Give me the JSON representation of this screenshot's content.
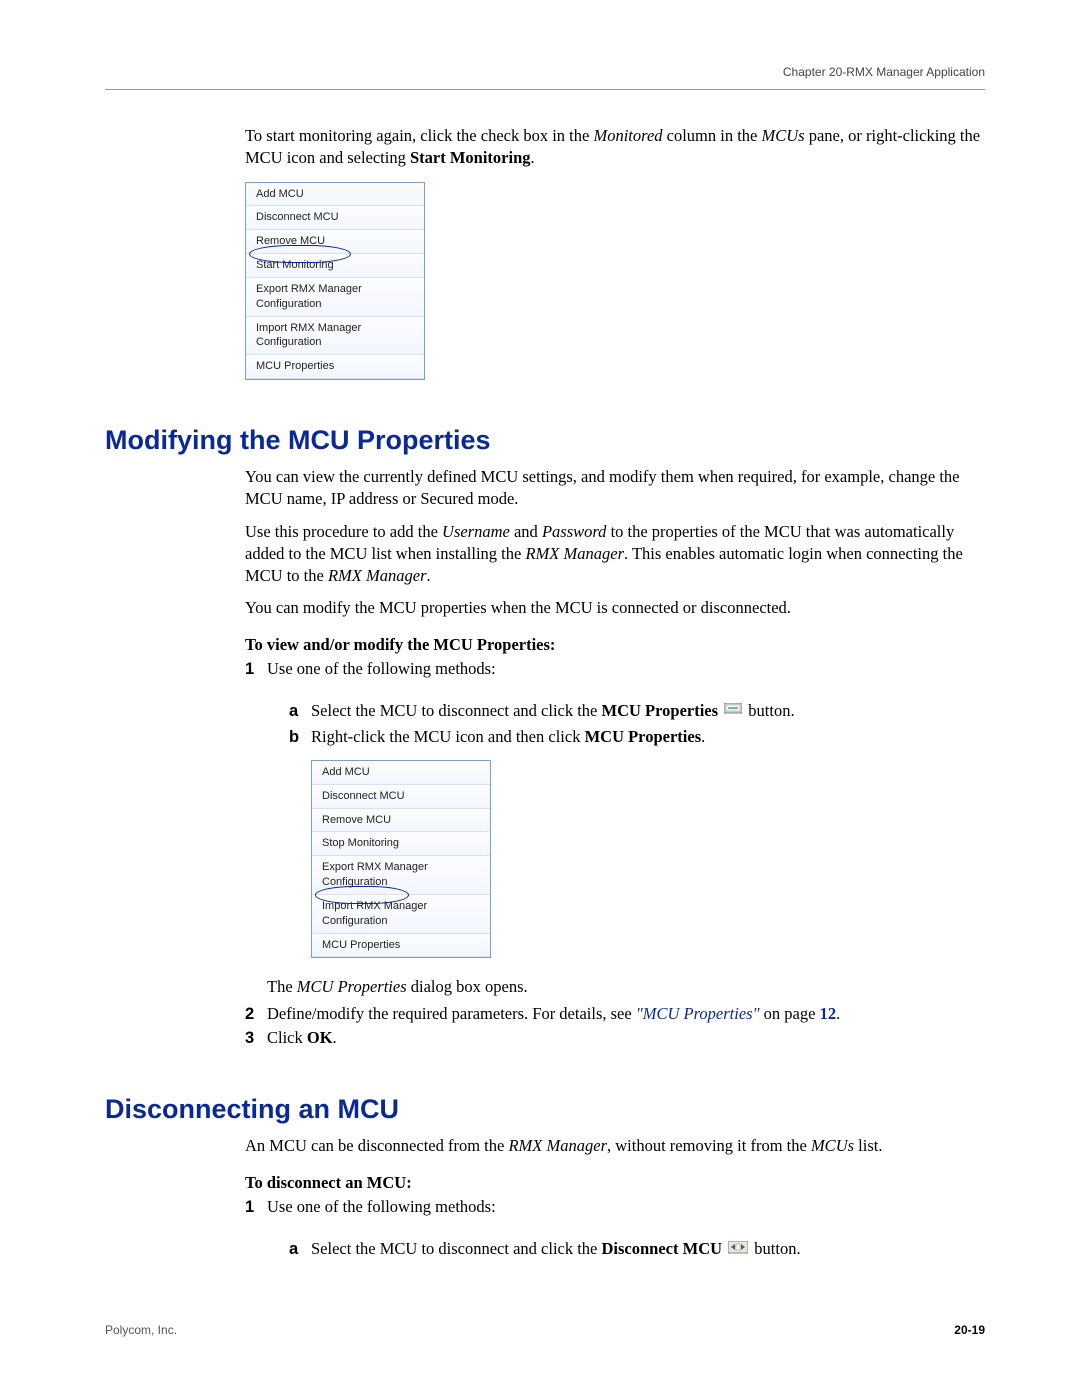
{
  "header": {
    "chapter": "Chapter 20-RMX Manager Application"
  },
  "intro": {
    "p1a": "To start monitoring again, click the check box in the ",
    "p1b": "Monitored",
    "p1c": " column in the ",
    "p1d": "MCUs",
    "p1e": " pane, or right-clicking the MCU icon and selecting ",
    "p1f": "Start Monitoring",
    "p1g": "."
  },
  "menu1": {
    "items": [
      "Add MCU",
      "Disconnect MCU",
      "Remove MCU",
      "Start Monitoring",
      "Export RMX Manager Configuration",
      "Import RMX Manager Configuration",
      "MCU Properties"
    ]
  },
  "sec1": {
    "heading": "Modifying the MCU Properties",
    "p1": "You can view the currently defined MCU settings, and modify them when required, for example, change the MCU name, IP address or Secured mode.",
    "p2a": "Use this procedure to add the ",
    "p2b": "Username",
    "p2c": " and ",
    "p2d": "Password",
    "p2e": " to the properties of the MCU that was automatically added to the MCU list when installing the ",
    "p2f": "RMX Manager",
    "p2g": ". This enables automatic login when connecting the MCU to the ",
    "p2h": "RMX Manager",
    "p2i": ".",
    "p3": "You can modify the MCU properties when the MCU is connected or disconnected.",
    "task": "To view and/or modify the MCU Properties:",
    "s1": "Use one of the following methods:",
    "s1a_a": "Select the MCU to disconnect and click the ",
    "s1a_b": "MCU Properties",
    "s1a_c": " button.",
    "s1b_a": "Right-click the MCU icon and then click ",
    "s1b_b": "MCU Properties",
    "s1b_c": ".",
    "post_menu_a": "The ",
    "post_menu_b": "MCU Properties",
    "post_menu_c": " dialog box opens.",
    "s2a": "Define/modify the required parameters. For details, see ",
    "s2b": "\"MCU Properties\"",
    "s2c": " on page ",
    "s2d": "12",
    "s2e": ".",
    "s3a": "Click ",
    "s3b": "OK",
    "s3c": "."
  },
  "menu2": {
    "items": [
      "Add MCU",
      "Disconnect MCU",
      "Remove MCU",
      "Stop Monitoring",
      "Export RMX Manager Configuration",
      "Import RMX Manager Configuration",
      "MCU Properties"
    ]
  },
  "sec2": {
    "heading": "Disconnecting an MCU",
    "p1a": "An MCU can be disconnected from the ",
    "p1b": "RMX Manager",
    "p1c": ", without removing it from the ",
    "p1d": "MCUs",
    "p1e": " list.",
    "task": "To disconnect an MCU:",
    "s1": "Use one of the following methods:",
    "s1a_a": "Select the MCU to disconnect and click the ",
    "s1a_b": "Disconnect MCU",
    "s1a_c": " button."
  },
  "footer": {
    "left": "Polycom, Inc.",
    "right": "20-19"
  }
}
